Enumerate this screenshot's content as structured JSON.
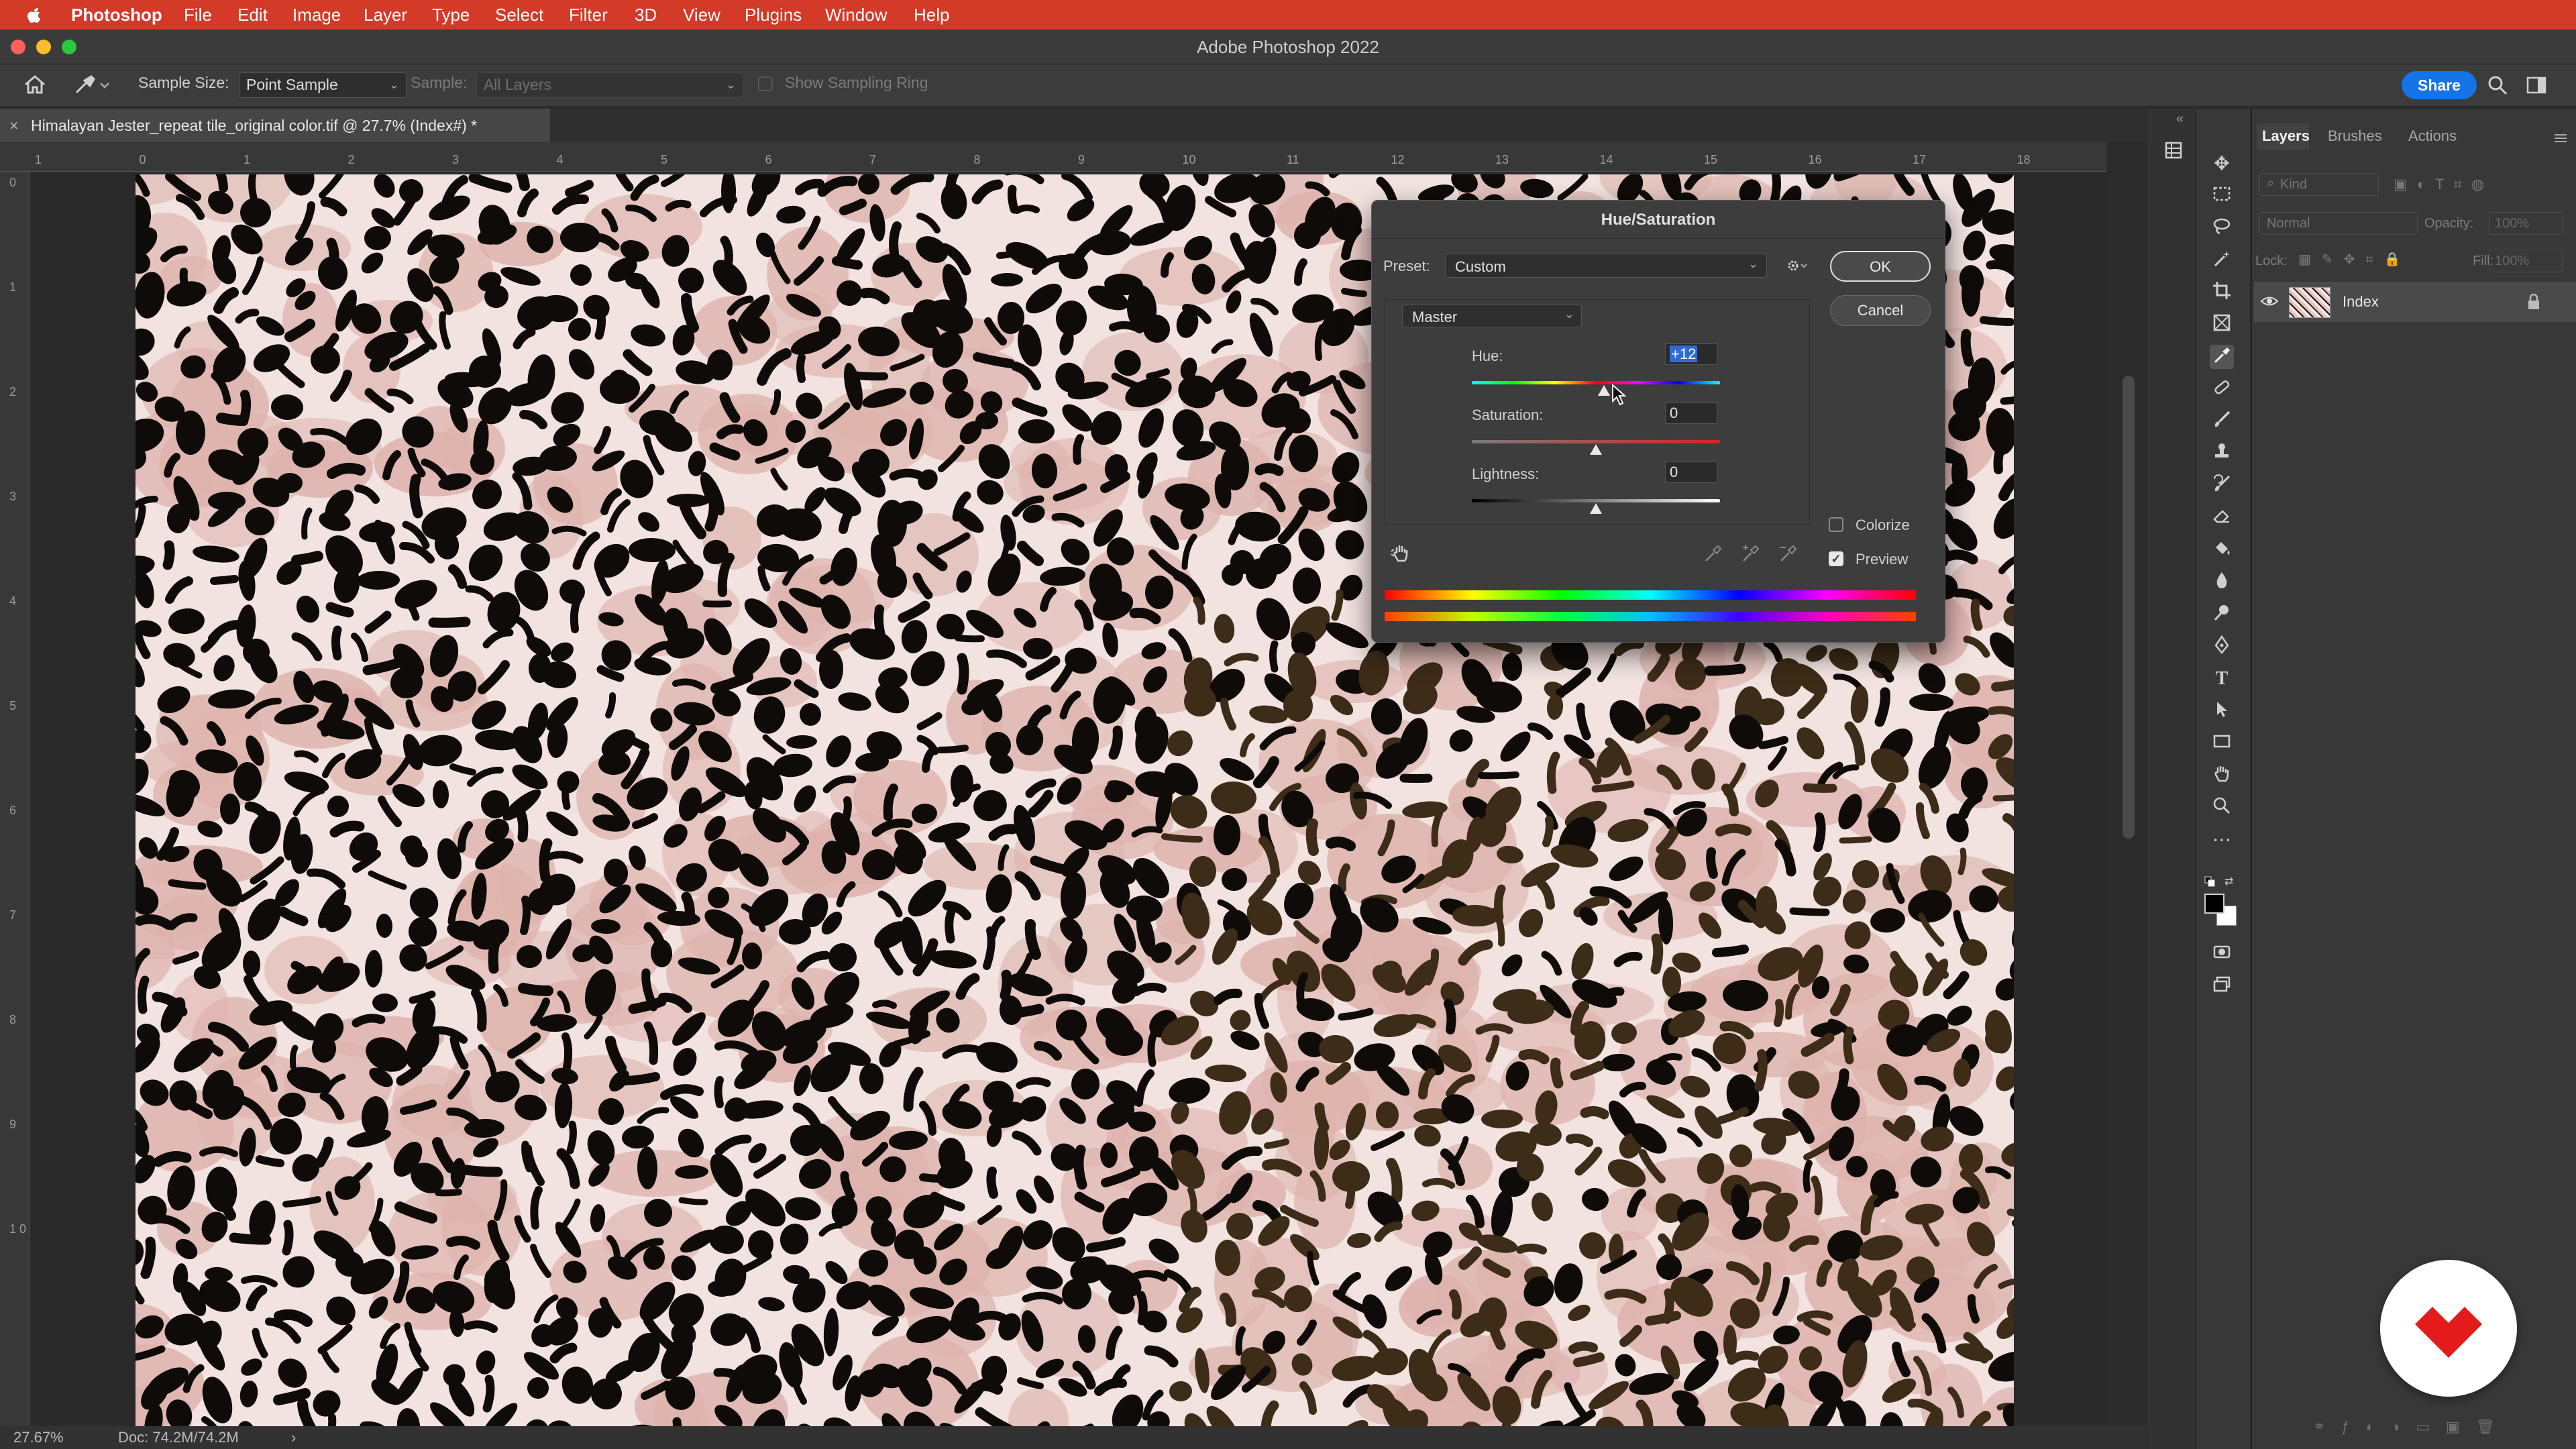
{
  "menubar": {
    "apple": "",
    "items": [
      "Photoshop",
      "File",
      "Edit",
      "Image",
      "Layer",
      "Type",
      "Select",
      "Filter",
      "3D",
      "View",
      "Plugins",
      "Window",
      "Help"
    ]
  },
  "window": {
    "title": "Adobe Photoshop 2022"
  },
  "options": {
    "sample_size_label": "Sample Size:",
    "sample_size_value": "Point Sample",
    "sample_label": "Sample:",
    "sample_value": "All Layers",
    "sampling_ring_label": "Show Sampling Ring",
    "share_label": "Share"
  },
  "document": {
    "tab_title": "Himalayan Jester_repeat tile_original color.tif @ 27.7% (Index#) *",
    "close_glyph": "×"
  },
  "rulers": {
    "h": [
      "1",
      "0",
      "1",
      "2",
      "3",
      "4",
      "5",
      "6",
      "7",
      "8",
      "9",
      "10",
      "11",
      "12",
      "13",
      "14",
      "15",
      "16",
      "17",
      "18"
    ],
    "v": [
      "0",
      "1",
      "2",
      "3",
      "4",
      "5",
      "6",
      "7",
      "8",
      "9",
      "1 0"
    ]
  },
  "status": {
    "zoom": "27.67%",
    "doc": "Doc: 74.2M/74.2M",
    "arrow": "›"
  },
  "panel": {
    "tabs": [
      "Layers",
      "Brushes",
      "Actions"
    ],
    "filter_placeholder": "Kind",
    "blend_mode": "Normal",
    "opacity_label": "Opacity:",
    "opacity_value": "100%",
    "lock_label": "Lock:",
    "fill_label": "Fill:",
    "fill_value": "100%",
    "layer_name": "Index"
  },
  "dialog": {
    "title": "Hue/Saturation",
    "preset_label": "Preset:",
    "preset_value": "Custom",
    "channel_value": "Master",
    "hue_label": "Hue:",
    "hue_value": "+12",
    "saturation_label": "Saturation:",
    "saturation_value": "0",
    "lightness_label": "Lightness:",
    "lightness_value": "0",
    "ok_label": "OK",
    "cancel_label": "Cancel",
    "colorize_label": "Colorize",
    "colorize_checked": false,
    "preview_label": "Preview",
    "preview_checked": true,
    "hue_range": [
      -180,
      180
    ],
    "sat_range": [
      -100,
      100
    ],
    "light_range": [
      -100,
      100
    ],
    "hue_num": 12,
    "sat_num": 0,
    "light_num": 0
  },
  "colors": {
    "menubar": "#d33a28",
    "accent": "#1473e6",
    "pattern_bg": "#f2e3e1",
    "pattern_pink": "#deb3ad",
    "pattern_spot": "#0e0b08",
    "pattern_brown": "#3c2c18"
  }
}
